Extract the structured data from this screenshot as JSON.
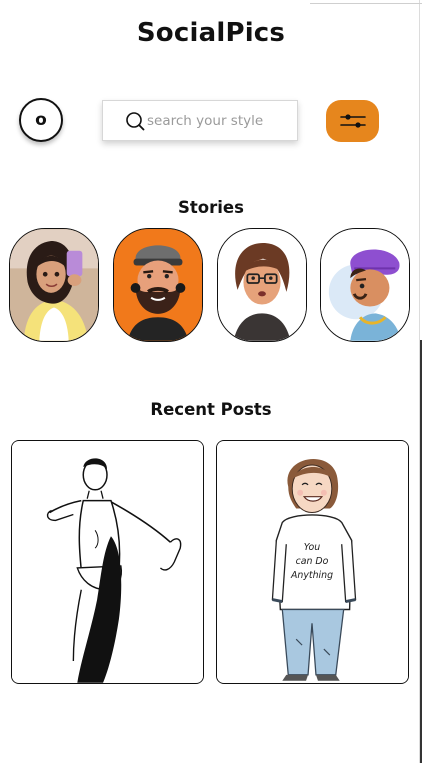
{
  "app": {
    "title": "SocialPics"
  },
  "header": {
    "profile_initial": "o"
  },
  "search": {
    "placeholder": "search your style",
    "value": ""
  },
  "icons": {
    "search": "search-icon",
    "filter": "slider-filter-icon"
  },
  "colors": {
    "accent": "#e6861d",
    "story_orange": "#f1791b"
  },
  "stories": {
    "title": "Stories"
  },
  "posts": {
    "title": "Recent Posts",
    "items": [
      {
        "tshirt_text": ""
      },
      {
        "tshirt_text": "You can Do Anything"
      }
    ]
  }
}
